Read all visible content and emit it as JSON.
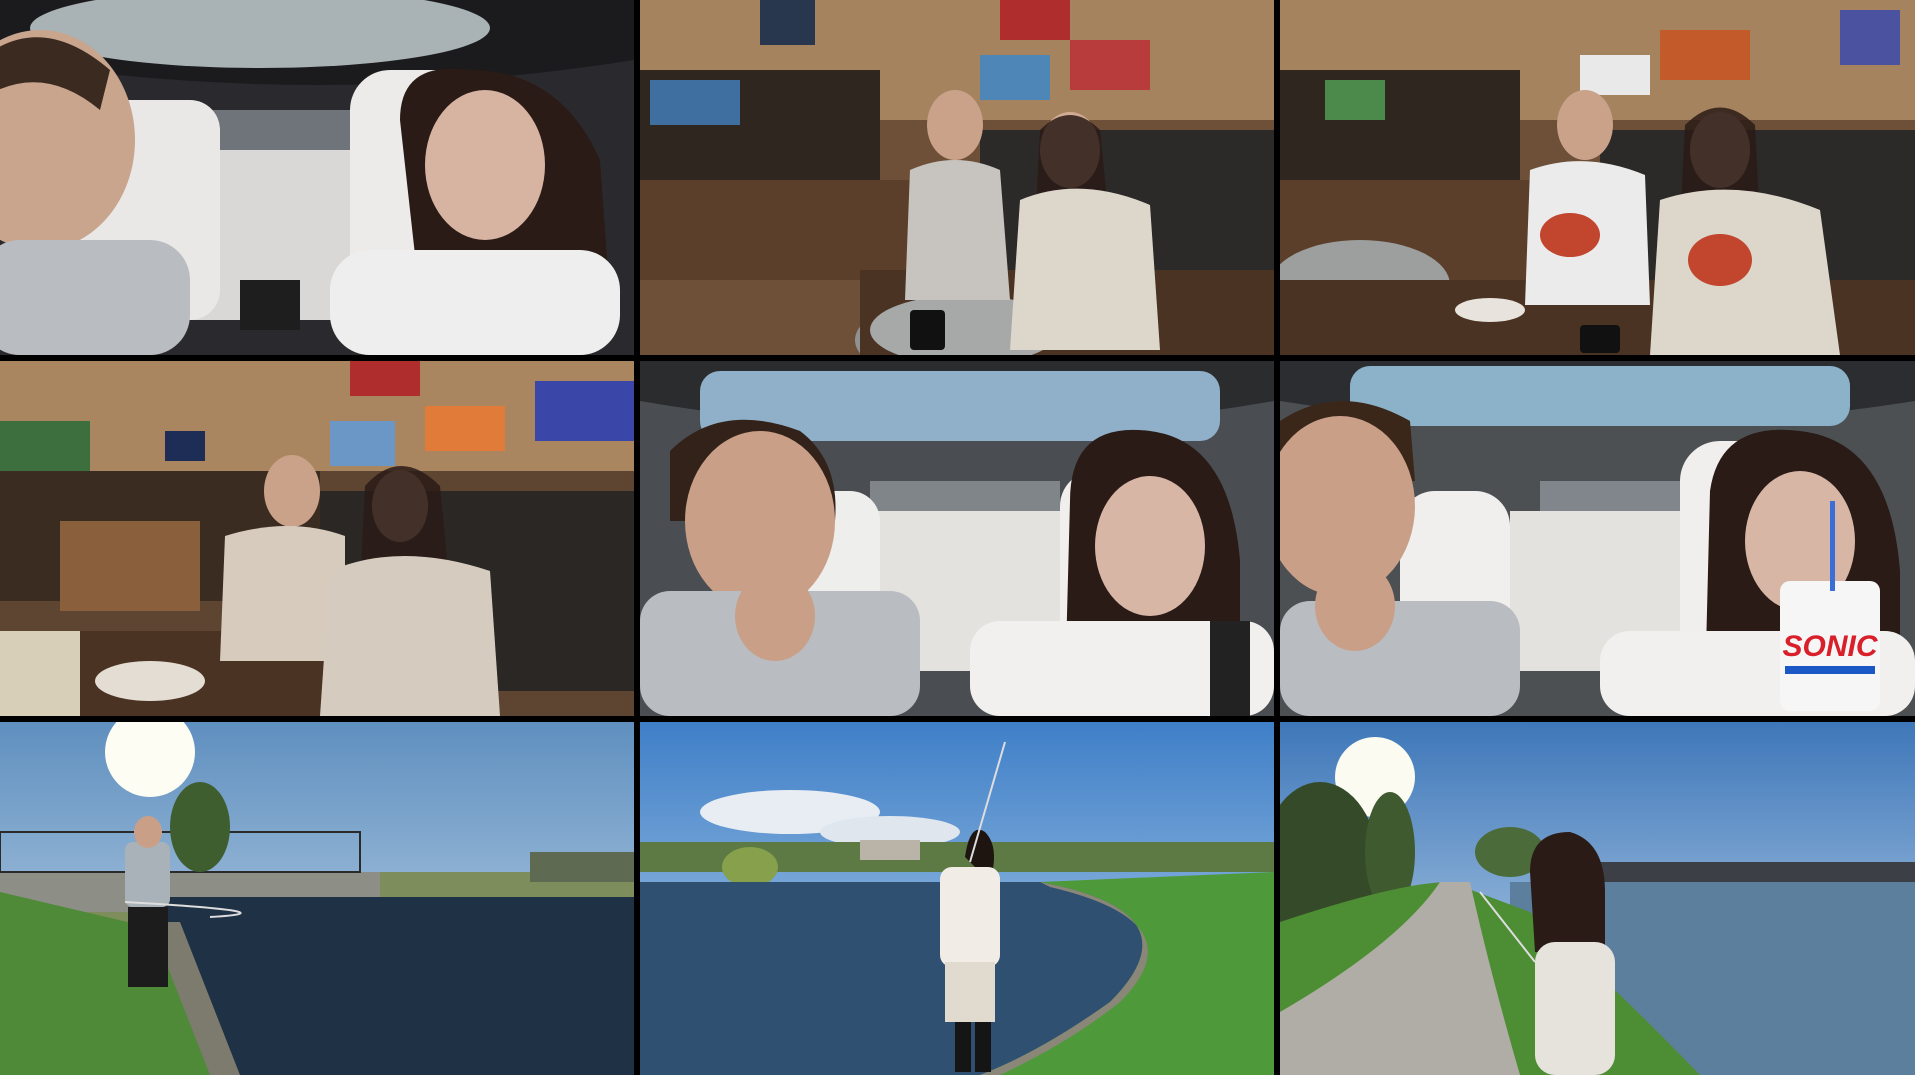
{
  "grid": {
    "rows": 3,
    "columns": 3
  },
  "tiles": [
    {
      "scene": "car-interior",
      "people": 2
    },
    {
      "scene": "sports-bar",
      "people": 2
    },
    {
      "scene": "sports-bar",
      "people": 2
    },
    {
      "scene": "sports-bar",
      "people": 2
    },
    {
      "scene": "car-interior",
      "people": 2
    },
    {
      "scene": "car-interior",
      "people": 2
    },
    {
      "scene": "pond-fishing",
      "people": 1
    },
    {
      "scene": "pond-fishing",
      "people": 1
    },
    {
      "scene": "pond-fishing",
      "people": 1
    }
  ],
  "cup_logo": "SONIC"
}
